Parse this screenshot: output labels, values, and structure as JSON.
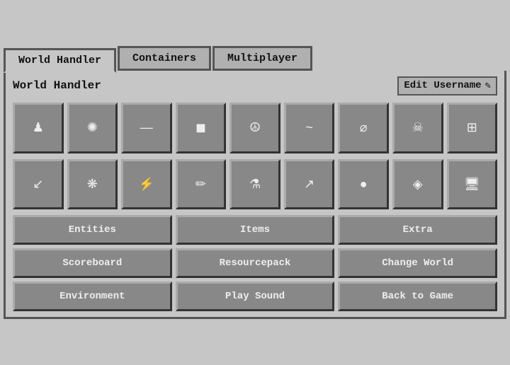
{
  "tabs": [
    {
      "label": "World Handler",
      "active": true
    },
    {
      "label": "Containers",
      "active": false
    },
    {
      "label": "Multiplayer",
      "active": false
    }
  ],
  "panel": {
    "title": "World Handler",
    "edit_username_label": "Edit Username"
  },
  "icon_rows": [
    [
      {
        "symbol": "♟",
        "name": "chess-pawn"
      },
      {
        "symbol": "✺",
        "name": "sparkle"
      },
      {
        "symbol": "—",
        "name": "dash"
      },
      {
        "symbol": "◼",
        "name": "square"
      },
      {
        "symbol": "☮",
        "name": "peace"
      },
      {
        "symbol": "~",
        "name": "tilde"
      },
      {
        "symbol": "⌀",
        "name": "diameter"
      },
      {
        "symbol": "☠",
        "name": "skull"
      },
      {
        "symbol": "⊞",
        "name": "grid"
      }
    ],
    [
      {
        "symbol": "↙",
        "name": "arrow-down-left"
      },
      {
        "symbol": "❋",
        "name": "star-cluster"
      },
      {
        "symbol": "⚡",
        "name": "lightning"
      },
      {
        "symbol": "✏",
        "name": "pencil"
      },
      {
        "symbol": "⚗",
        "name": "flask"
      },
      {
        "symbol": "↗",
        "name": "arrow-up-right"
      },
      {
        "symbol": "●",
        "name": "circle"
      },
      {
        "symbol": "◈",
        "name": "diamond"
      },
      {
        "symbol": "📺",
        "name": "screen"
      }
    ]
  ],
  "action_buttons": [
    [
      "Entities",
      "Items",
      "Extra"
    ],
    [
      "Scoreboard",
      "Resourcepack",
      "Change World"
    ],
    [
      "Environment",
      "Play Sound",
      "Back to Game"
    ]
  ]
}
